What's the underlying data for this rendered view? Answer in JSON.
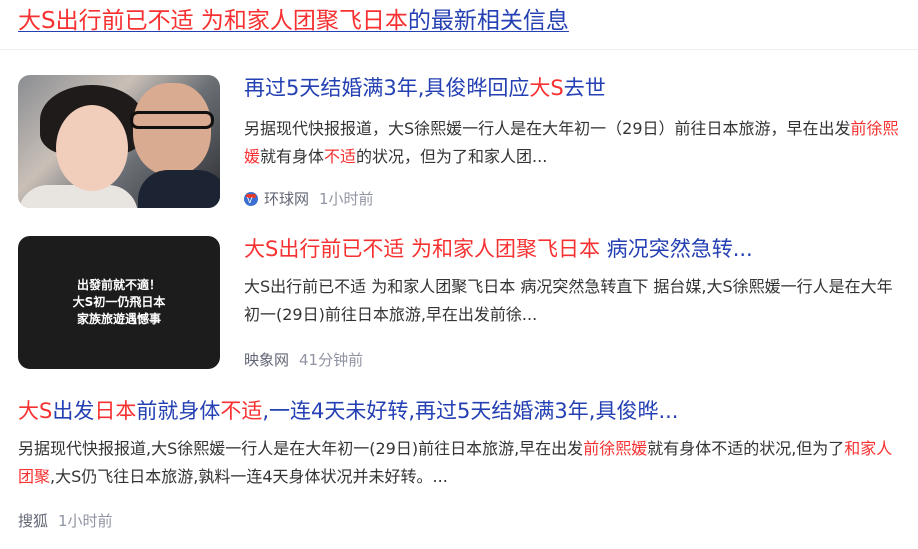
{
  "header": {
    "title_hl": "大S出行前已不适 为和家人团聚飞日本",
    "title_rest": "的最新相关信息"
  },
  "results": [
    {
      "title_parts": [
        {
          "text": "再过5天结婚满3年,具俊晔回应",
          "hl": false
        },
        {
          "text": "大S",
          "hl": true
        },
        {
          "text": "去世",
          "hl": false
        }
      ],
      "summary_parts": [
        {
          "text": "另据现代快报报道，大S徐熙媛一行人是在大年初一（29日）前往日本旅游，早在出发",
          "hl": false
        },
        {
          "text": "前徐熙媛",
          "hl": true
        },
        {
          "text": "就有身体",
          "hl": false
        },
        {
          "text": "不适",
          "hl": true
        },
        {
          "text": "的状况，但为了和家人团...",
          "hl": false
        }
      ],
      "source_icon": "huanqiu-logo-icon",
      "source": "环球网",
      "time": "1小时前"
    },
    {
      "thumb_lines": [
        "出發前就不適！",
        "大S初一仍飛日本",
        "家族旅遊遇憾事"
      ],
      "title_parts": [
        {
          "text": "大S出行前已不适 为和家人团聚飞日本",
          "hl": true
        },
        {
          "text": " 病况突然急转...",
          "hl": false
        }
      ],
      "summary_parts": [
        {
          "text": "大S出行前已不适 为和家人团聚飞日本 病况突然急转直下 据台媒,大S徐熙媛一行人是在大年初一(29日)前往日本旅游,早在出发前徐...",
          "hl": false
        }
      ],
      "source": "映象网",
      "time": "41分钟前"
    },
    {
      "title_parts": [
        {
          "text": "大S",
          "hl": true
        },
        {
          "text": "出发",
          "hl": false
        },
        {
          "text": "日本",
          "hl": true
        },
        {
          "text": "前就身体",
          "hl": false
        },
        {
          "text": "不适",
          "hl": true
        },
        {
          "text": ",一连4天未好转,再过5天结婚满3年,具俊晔...",
          "hl": false
        }
      ],
      "summary_parts": [
        {
          "text": "另据现代快报报道,大S徐熙媛一行人是在大年初一(29日)前往日本旅游,早在出发",
          "hl": false
        },
        {
          "text": "前徐熙媛",
          "hl": true
        },
        {
          "text": "就有身体不适的状况,但为了",
          "hl": false
        },
        {
          "text": "和家人团聚",
          "hl": true
        },
        {
          "text": ",大S仍飞往日本旅游,孰料一连4天身体状况并未好转。...",
          "hl": false
        }
      ],
      "source": "搜狐",
      "time": "1小时前"
    }
  ]
}
